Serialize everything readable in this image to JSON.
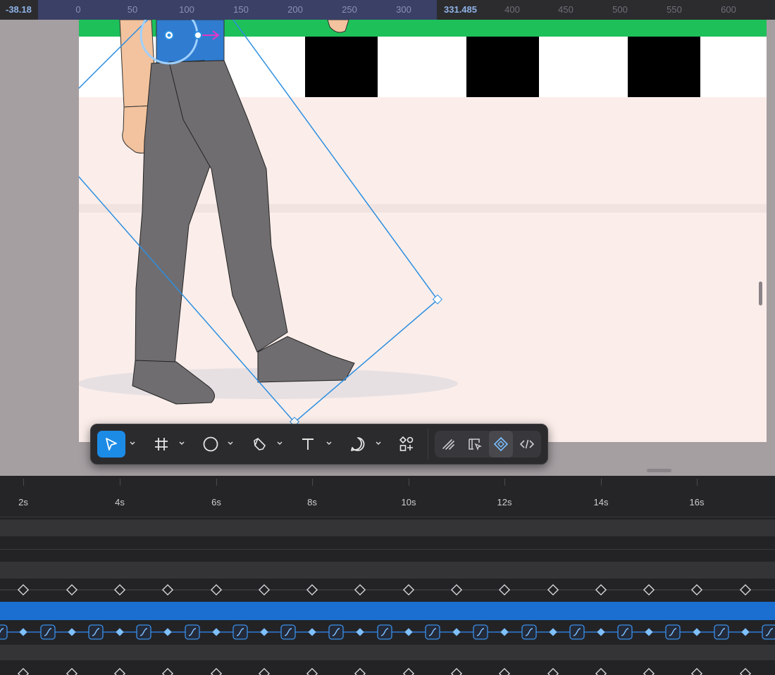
{
  "ruler": {
    "left_value": "-38.18",
    "right_value": "331.485",
    "ticks": [
      "0",
      "50",
      "100",
      "150",
      "200",
      "250",
      "300",
      "400",
      "450",
      "500",
      "550",
      "600"
    ]
  },
  "toolbar": {
    "tools": [
      "select-tool",
      "frame-tool",
      "shape-tool",
      "pen-tool",
      "text-tool",
      "comment-tool",
      "components-tool"
    ],
    "right_tools": [
      "draw-tool",
      "dev-tool",
      "prototype-tool",
      "code-tool"
    ],
    "active_tool": "select-tool"
  },
  "timeline": {
    "labels": [
      "2s",
      "4s",
      "6s",
      "8s",
      "10s",
      "12s",
      "14s",
      "16s"
    ],
    "keyframe_rows": 3,
    "selected_track_color": "#1a6fd1"
  },
  "colors": {
    "accent": "#1c8be6",
    "selection_box": "#2d8fe0",
    "pants": "#6f6d70",
    "skin": "#f2c39e",
    "shirt": "#2f7cd0",
    "wall_green": "#1ec05a"
  }
}
